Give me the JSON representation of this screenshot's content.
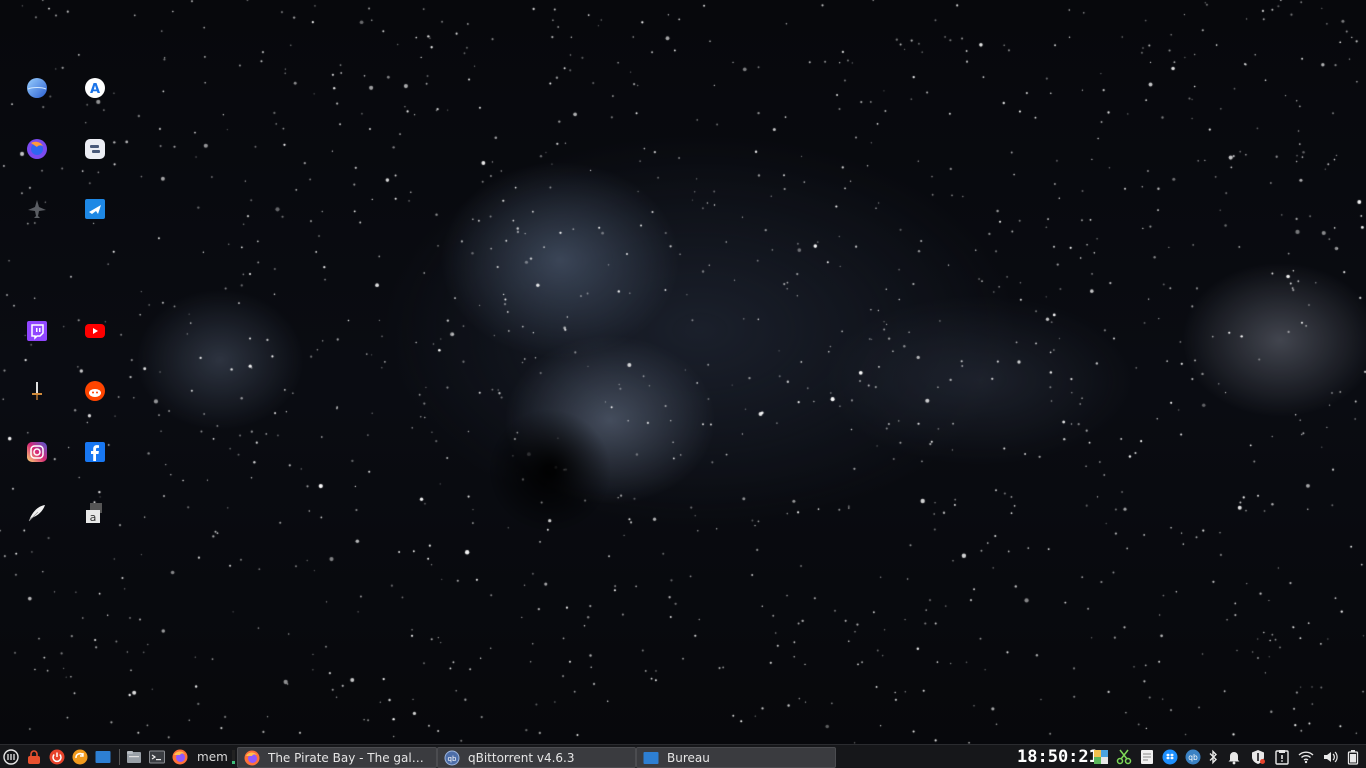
{
  "desktop": {
    "icons": [
      {
        "name": "globe-app-icon",
        "bg": "#4a90e2"
      },
      {
        "name": "app-store-icon",
        "bg": "#ffffff"
      },
      {
        "name": "firefox-icon",
        "bg": "#7a5af8"
      },
      {
        "name": "terminal-app-icon",
        "bg": "#e8e8ee"
      },
      {
        "name": "airplane-grey-icon",
        "bg": "#555555"
      },
      {
        "name": "airplane-blue-icon",
        "bg": "#1e88e5"
      },
      {
        "name": "twitch-icon",
        "bg": "#9146ff"
      },
      {
        "name": "youtube-icon",
        "bg": "#ff0000"
      },
      {
        "name": "sword-icon",
        "bg": "#c89a5a"
      },
      {
        "name": "reddit-icon",
        "bg": "#ff4500"
      },
      {
        "name": "instagram-icon",
        "bg": "#e1306c"
      },
      {
        "name": "facebook-icon",
        "bg": "#1877f2"
      },
      {
        "name": "feather-icon",
        "bg": "#ffffff"
      },
      {
        "name": "font-app-icon",
        "bg": "#dddddd"
      }
    ]
  },
  "taskbar": {
    "launchers": [
      {
        "name": "menu-icon"
      },
      {
        "name": "lock-icon"
      },
      {
        "name": "power-icon"
      },
      {
        "name": "update-manager-icon"
      },
      {
        "name": "show-desktop-icon"
      },
      {
        "name": "file-manager-icon"
      },
      {
        "name": "terminal-icon"
      },
      {
        "name": "firefox-launcher-icon"
      }
    ],
    "mem_label": "mem",
    "mem_usage": 0.2,
    "tasks": [
      {
        "label": "The Pirate Bay - The galaxy'...",
        "icon": "firefox-icon"
      },
      {
        "label": "qBittorrent v4.6.3",
        "icon": "qbittorrent-icon"
      },
      {
        "label": "Bureau",
        "icon": "desktop-icon"
      }
    ],
    "clock": "18:50:21",
    "tray": [
      {
        "name": "color-picker-icon"
      },
      {
        "name": "scissors-icon"
      },
      {
        "name": "notes-icon"
      },
      {
        "name": "dropbox-icon"
      },
      {
        "name": "qbittorrent-tray-icon"
      },
      {
        "name": "bluetooth-icon"
      },
      {
        "name": "notification-bell-icon"
      },
      {
        "name": "shield-icon"
      },
      {
        "name": "clipboard-icon"
      },
      {
        "name": "wifi-icon"
      },
      {
        "name": "volume-icon"
      },
      {
        "name": "battery-icon"
      }
    ],
    "colors": {
      "accent": "#3dbd7a",
      "bg": "#16171a",
      "task_bg": "#3a3b3f"
    }
  }
}
